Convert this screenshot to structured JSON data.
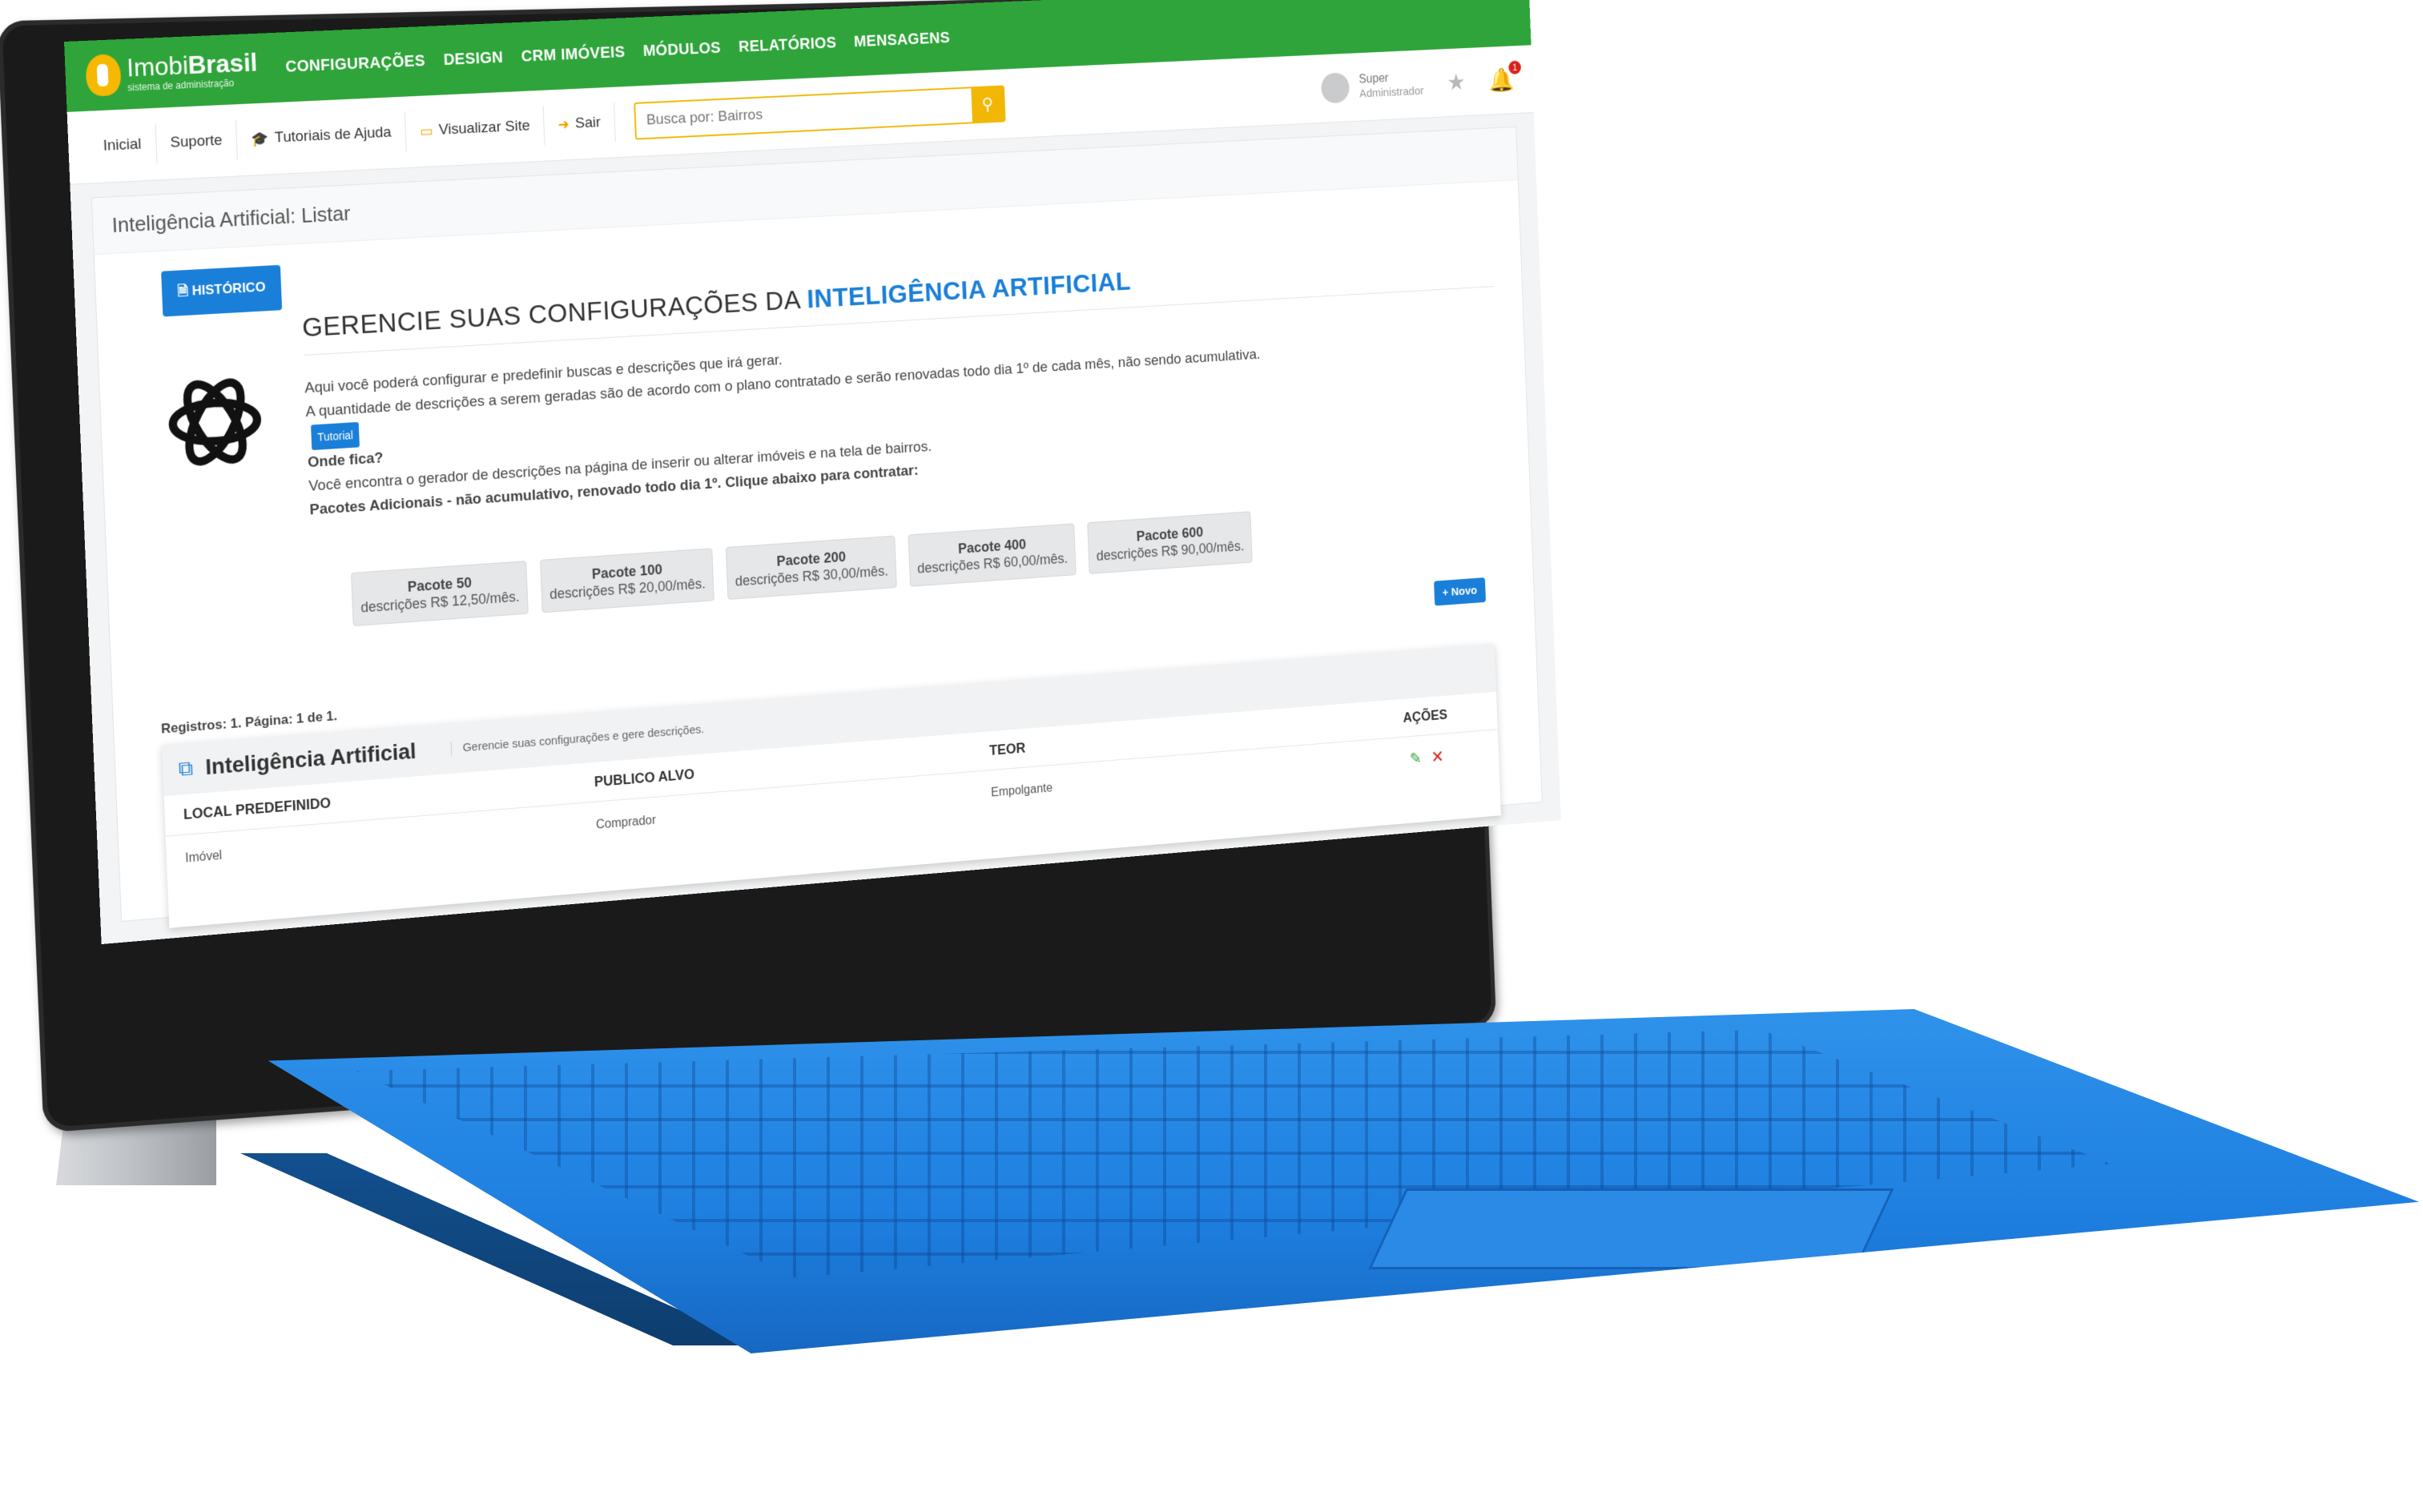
{
  "header": {
    "logo_main": "Imobi",
    "logo_bold": "Brasil",
    "logo_sub": "sistema de administração",
    "menu": [
      "CONFIGURAÇÕES",
      "DESIGN",
      "CRM IMÓVEIS",
      "MÓDULOS",
      "RELATÓRIOS",
      "MENSAGENS"
    ]
  },
  "subnav": {
    "links": [
      {
        "label": "Inicial",
        "icon": ""
      },
      {
        "label": "Suporte",
        "icon": ""
      },
      {
        "label": "Tutoriais de Ajuda",
        "icon": "graduation-cap-icon"
      },
      {
        "label": "Visualizar Site",
        "icon": "monitor-icon"
      },
      {
        "label": "Sair",
        "icon": "exit-icon"
      }
    ],
    "search_placeholder": "Busca por: Bairros",
    "user_name": "Super",
    "user_role": "Administrador",
    "notifications": "1"
  },
  "page": {
    "title": "Inteligência Artificial: Listar",
    "history_button": "HISTÓRICO",
    "heading_plain": "GERENCIE SUAS CONFIGURAÇÕES DA ",
    "heading_accent": "INTELIGÊNCIA ARTIFICIAL",
    "line1": "Aqui você poderá configurar e predefinir buscas e descrições que irá gerar.",
    "line2": "A quantidade de descrições a serem geradas são de acordo com o plano contratado e serão renovadas todo dia 1º de cada mês, não sendo acumulativa.",
    "line3": "Tutorial",
    "where_title": "Onde fica?",
    "where_text": "Você encontra o gerador de descrições na página de inserir ou alterar imóveis e na tela de bairros.",
    "packs_title": "Pacotes Adicionais - não acumulativo, renovado todo dia 1º. Clique abaixo para contratar:",
    "packs": [
      {
        "name": "Pacote 50",
        "price": "descrições R$ 12,50/mês."
      },
      {
        "name": "Pacote 100",
        "price": "descrições R$ 20,00/mês."
      },
      {
        "name": "Pacote 200",
        "price": "descrições R$ 30,00/mês."
      },
      {
        "name": "Pacote 400",
        "price": "descrições R$ 60,00/mês."
      },
      {
        "name": "Pacote 600",
        "price": "descrições R$ 90,00/mês."
      }
    ],
    "new_button": "+ Novo",
    "registros": "Registros: 1. Página: 1 de 1."
  },
  "table": {
    "title": "Inteligência Artificial",
    "subtitle": "Gerencie suas configurações e gere descrições.",
    "columns": [
      "LOCAL PREDEFINIDO",
      "PUBLICO ALVO",
      "TEOR",
      "AÇÕES"
    ],
    "rows": [
      {
        "local": "Imóvel",
        "publico": "Comprador",
        "teor": "Empolgante"
      }
    ]
  },
  "pagination": {
    "current": "1"
  },
  "colors": {
    "brand_green": "#2ea43a",
    "accent_blue": "#1a7fd8",
    "search_yellow": "#f2b705",
    "keyboard_blue": "#1e7fe0"
  }
}
